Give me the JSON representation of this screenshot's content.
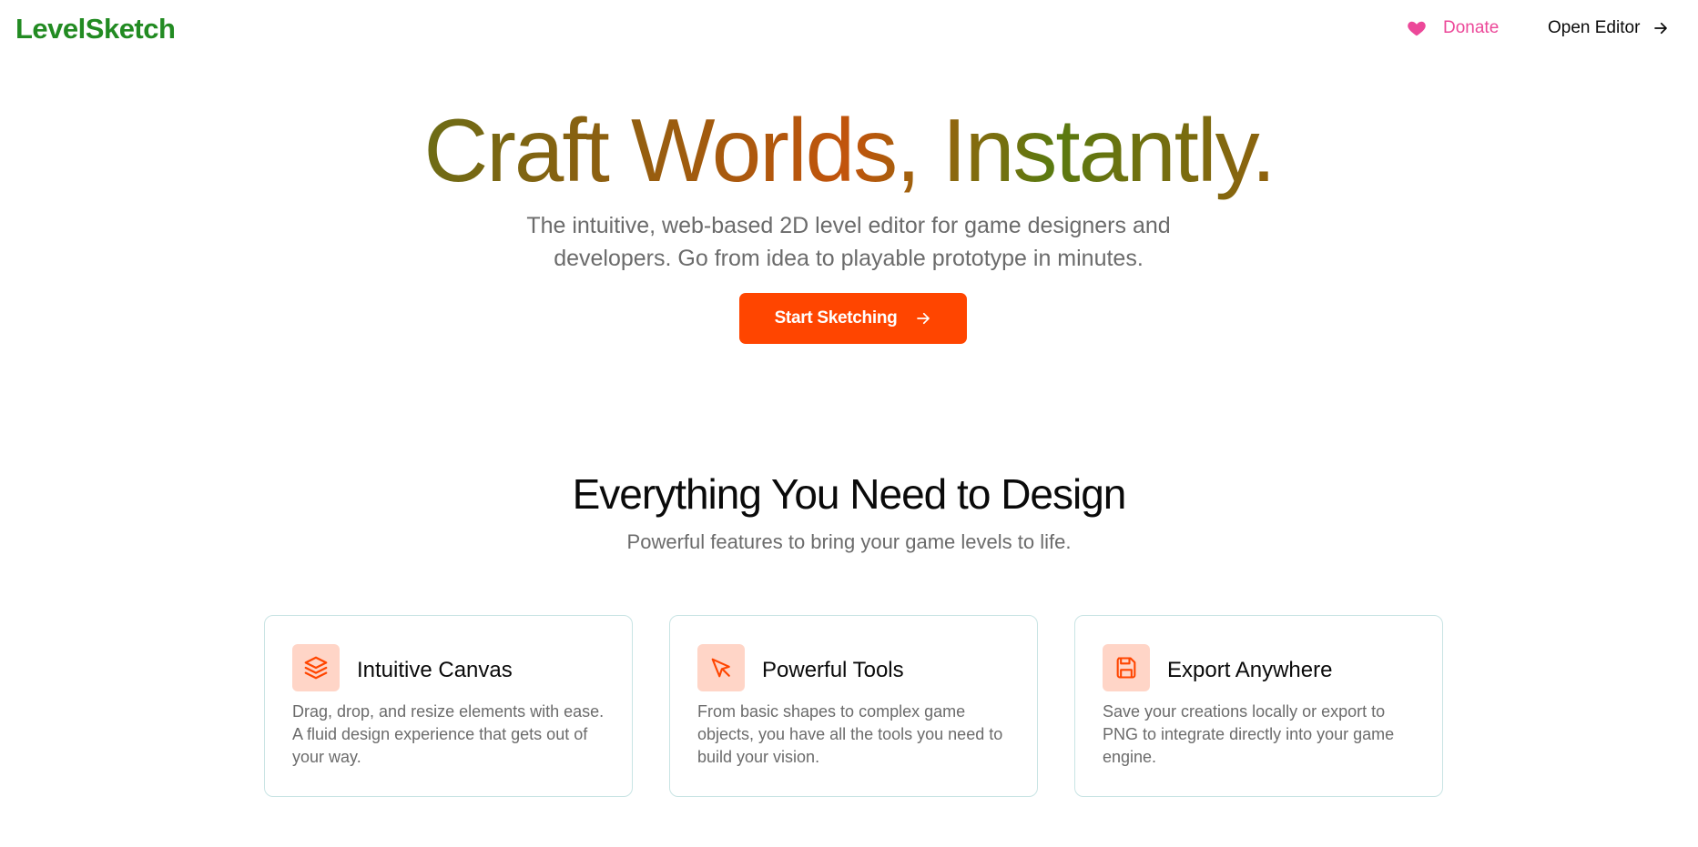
{
  "header": {
    "logo": "LevelSketch",
    "donate_label": "Donate",
    "open_editor_label": "Open Editor",
    "icons": {
      "donate": "heart-icon",
      "open_editor": "arrow-right-icon"
    }
  },
  "hero": {
    "title": "Craft Worlds, Instantly.",
    "subtitle": "The intuitive, web-based 2D level editor for game designers and developers. Go from idea to playable prototype in minutes.",
    "cta_label": "Start Sketching",
    "cta_icon": "arrow-right-icon"
  },
  "features": {
    "title": "Everything You Need to Design",
    "subtitle": "Powerful features to bring your game levels to life.",
    "cards": [
      {
        "icon": "layers-icon",
        "title": "Intuitive Canvas",
        "description": "Drag, drop, and resize elements with ease. A fluid design experience that gets out of your way."
      },
      {
        "icon": "cursor-pointer-icon",
        "title": "Powerful Tools",
        "description": "From basic shapes to complex game objects, you have all the tools you need to build your vision."
      },
      {
        "icon": "save-icon",
        "title": "Export Anywhere",
        "description": "Save your creations locally or export to PNG to integrate directly into your game engine."
      }
    ]
  },
  "colors": {
    "brand_green": "#228b22",
    "accent_orange": "#ff4500",
    "donate_pink": "#ec4899",
    "icon_bg": "#ffd5c7",
    "muted_text": "#6b6b6b"
  }
}
